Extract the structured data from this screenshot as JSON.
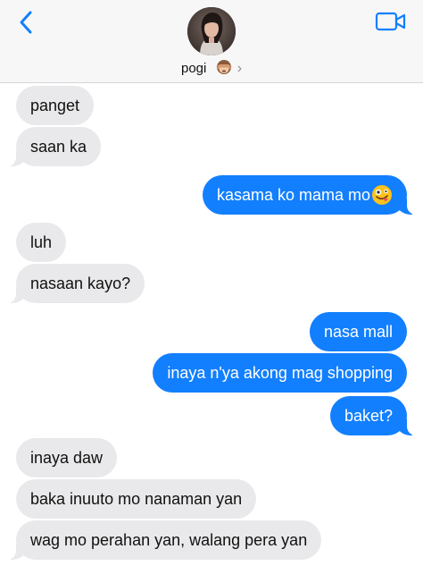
{
  "header": {
    "contact_name": "pogi",
    "contact_emoji": "see-no-evil-monkey-emoji",
    "back_icon": "chevron-left-icon",
    "video_icon": "video-camera-icon",
    "chevron_icon": "chevron-right-icon",
    "accent_color": "#127ffe"
  },
  "messages": [
    {
      "sender": "contact",
      "text": "panget"
    },
    {
      "sender": "contact",
      "text": "saan ka"
    },
    {
      "sender": "me",
      "text": "kasama ko mama mo",
      "emoji": "zany-face-emoji"
    },
    {
      "sender": "contact",
      "text": "luh"
    },
    {
      "sender": "contact",
      "text": "nasaan kayo?"
    },
    {
      "sender": "me",
      "text": "nasa mall"
    },
    {
      "sender": "me",
      "text": "inaya n'ya akong mag shopping"
    },
    {
      "sender": "me",
      "text": "baket?"
    },
    {
      "sender": "contact",
      "text": "inaya daw"
    },
    {
      "sender": "contact",
      "text": "baka inuuto mo nanaman yan"
    },
    {
      "sender": "contact",
      "text": "wag mo perahan yan, walang pera yan"
    }
  ],
  "colors": {
    "incoming_bubble": "#e9e9eb",
    "outgoing_bubble": "#127ffe"
  }
}
